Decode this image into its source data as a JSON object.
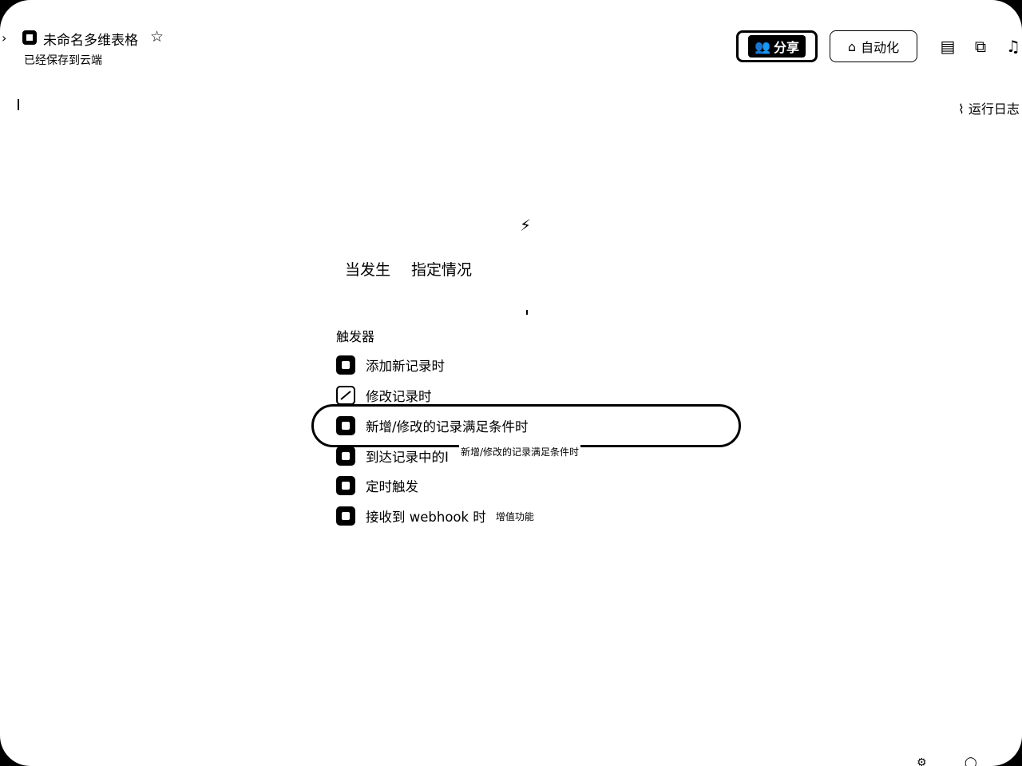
{
  "header": {
    "app_title": "未命名多维表格",
    "save_status": "已经保存到云端",
    "share_label": "分享",
    "automation_label": "自动化",
    "run_log_label": "运行日志"
  },
  "icons": {
    "back": "chevron-right-icon",
    "logo": "table-app-icon",
    "star": "star-icon",
    "share": "people-icon",
    "robot": "robot-icon",
    "doc": "document-icon",
    "plugin": "puzzle-icon",
    "bell": "bell-icon",
    "bolt": "lightning-icon",
    "chart": "trend-icon"
  },
  "trigger_tabs": [
    "当发生",
    "指定情况"
  ],
  "trigger_section_title": "触发器",
  "triggers": [
    {
      "label": "添加新记录时",
      "badge": ""
    },
    {
      "label": "修改记录时",
      "badge": ""
    },
    {
      "label": "新增/修改的记录满足条件时",
      "badge": ""
    },
    {
      "label": "到达记录中的I",
      "badge": ""
    },
    {
      "label": "定时触发",
      "badge": ""
    },
    {
      "label": "接收到 webhook 时",
      "badge": "增值功能"
    }
  ],
  "tooltip_text": "新增/修改的记录满足条件时",
  "highlighted_trigger": "新增/修改的记录满足条件时"
}
